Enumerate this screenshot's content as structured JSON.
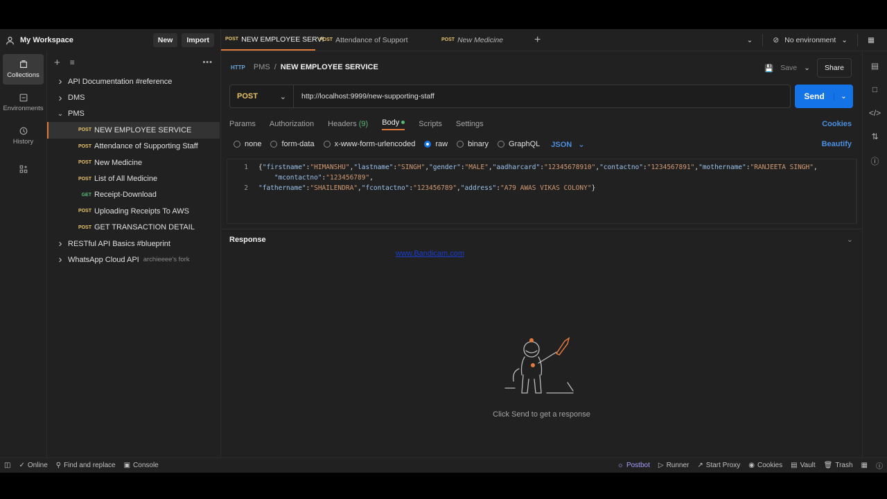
{
  "workspace": {
    "title": "My Workspace",
    "new_label": "New",
    "import_label": "Import"
  },
  "iconbar": [
    {
      "label": "Collections",
      "icon": "collections-icon",
      "active": true
    },
    {
      "label": "Environments",
      "icon": "environments-icon",
      "active": false
    },
    {
      "label": "History",
      "icon": "history-icon",
      "active": false
    }
  ],
  "tree": [
    {
      "type": "folder",
      "label": "API Documentation #reference",
      "expanded": false
    },
    {
      "type": "folder",
      "label": "DMS",
      "expanded": false
    },
    {
      "type": "folder",
      "label": "PMS",
      "expanded": true
    },
    {
      "type": "request",
      "method": "POST",
      "label": "NEW EMPLOYEE SERVICE",
      "active": true
    },
    {
      "type": "request",
      "method": "POST",
      "label": "Attendance of Supporting Staff"
    },
    {
      "type": "request",
      "method": "POST",
      "label": "New Medicine"
    },
    {
      "type": "request",
      "method": "POST",
      "label": "List of All Medicine"
    },
    {
      "type": "request",
      "method": "GET",
      "label": "Receipt-Download"
    },
    {
      "type": "request",
      "method": "POST",
      "label": "Uploading Receipts To AWS"
    },
    {
      "type": "request",
      "method": "POST",
      "label": "GET TRANSACTION DETAIL"
    },
    {
      "type": "folder",
      "label": "RESTful API Basics #blueprint",
      "expanded": false
    },
    {
      "type": "folder",
      "label": "WhatsApp Cloud API",
      "expanded": false,
      "fork": "archieeee's fork"
    }
  ],
  "tabs": [
    {
      "method": "POST",
      "label": "NEW EMPLOYEE SERVI",
      "active": true,
      "italic": false
    },
    {
      "method": "POST",
      "label": "Attendance of Support",
      "active": false,
      "italic": false
    },
    {
      "method": "POST",
      "label": "New Medicine",
      "active": false,
      "italic": true
    }
  ],
  "environment": {
    "label": "No environment"
  },
  "breadcrumb": {
    "http": "HTTP",
    "collection": "PMS",
    "separator": "/",
    "name": "NEW EMPLOYEE SERVICE"
  },
  "toolbar": {
    "save_label": "Save",
    "share_label": "Share"
  },
  "request": {
    "method": "POST",
    "url": "http://localhost:9999/new-supporting-staff",
    "send_label": "Send"
  },
  "req_tabs": {
    "params": "Params",
    "authorization": "Authorization",
    "headers": "Headers",
    "headers_count": "(9)",
    "body": "Body",
    "scripts": "Scripts",
    "settings": "Settings",
    "cookies": "Cookies"
  },
  "body_options": {
    "none": "none",
    "form_data": "form-data",
    "urlencoded": "x-www-form-urlencoded",
    "raw": "raw",
    "binary": "binary",
    "graphql": "GraphQL",
    "format": "JSON",
    "beautify": "Beautify"
  },
  "editor": {
    "line1_num": "1",
    "line2_num": "2"
  },
  "response": {
    "title": "Response",
    "watermark": "www.Bandicam.com",
    "empty_message": "Click Send to get a response"
  },
  "status_bar": {
    "online": "Online",
    "find_replace": "Find and replace",
    "console": "Console",
    "postbot": "Postbot",
    "runner": "Runner",
    "start_proxy": "Start Proxy",
    "cookies": "Cookies",
    "vault": "Vault",
    "trash": "Trash"
  }
}
